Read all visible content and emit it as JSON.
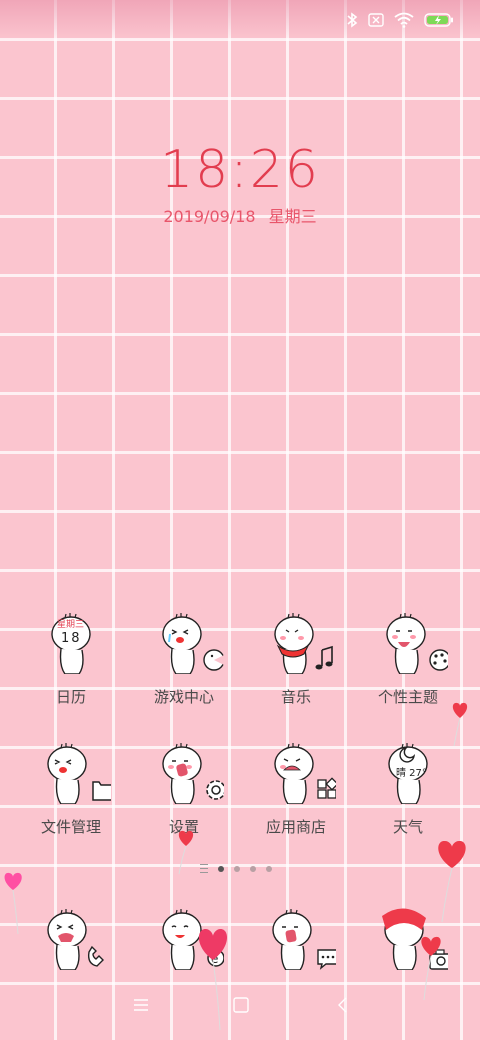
{
  "status_bar": {
    "icons": [
      "bluetooth-icon",
      "no-sim-icon",
      "wifi-icon",
      "battery-charging-icon"
    ]
  },
  "lockclock": {
    "time": "18:26",
    "date": "2019/09/18",
    "weekday": "星期三"
  },
  "calendar_icon": {
    "weekday": "星期三",
    "day": "18"
  },
  "weather_icon": {
    "temp": "晴 27°"
  },
  "apps": [
    {
      "label": "日历",
      "icon": "calendar-icon"
    },
    {
      "label": "游戏中心",
      "icon": "game-center-icon"
    },
    {
      "label": "音乐",
      "icon": "music-icon"
    },
    {
      "label": "个性主题",
      "icon": "themes-icon"
    },
    {
      "label": "文件管理",
      "icon": "file-manager-icon"
    },
    {
      "label": "设置",
      "icon": "settings-icon"
    },
    {
      "label": "应用商店",
      "icon": "app-store-icon"
    },
    {
      "label": "天气",
      "icon": "weather-icon"
    }
  ],
  "dock": [
    {
      "icon": "phone-icon"
    },
    {
      "icon": "browser-icon"
    },
    {
      "icon": "messages-icon"
    },
    {
      "icon": "camera-icon"
    }
  ],
  "page_indicator": {
    "pages": 4,
    "current": 1
  },
  "nav_bar": {
    "buttons": [
      "recents-icon",
      "home-icon",
      "back-icon"
    ]
  },
  "colors": {
    "accent": "#e23d4f",
    "background": "#fbc5cf",
    "balloon_red": "#ee3a4a",
    "balloon_magenta": "#ff4fa3"
  }
}
